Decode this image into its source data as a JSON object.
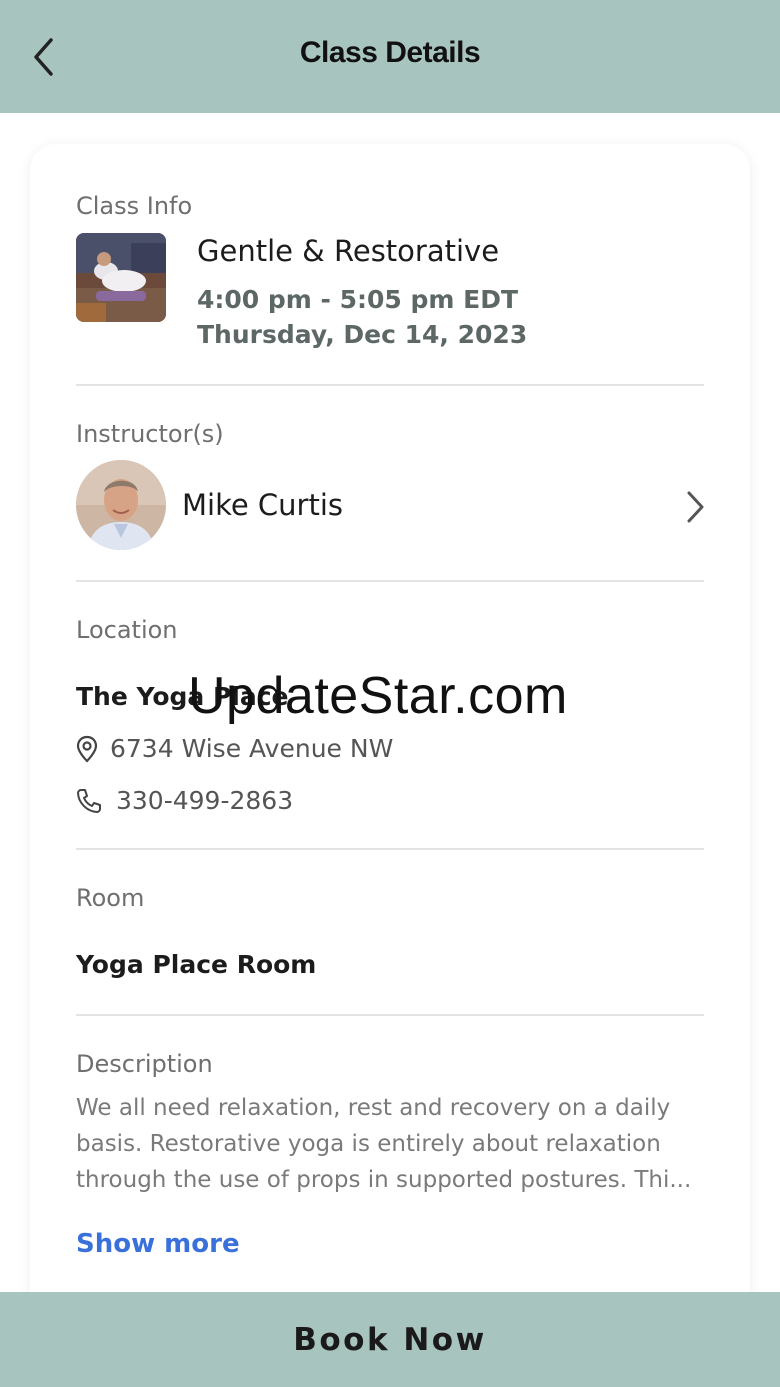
{
  "header": {
    "title": "Class Details",
    "back_icon": "chevron-left-icon"
  },
  "class_info": {
    "label": "Class Info",
    "name": "Gentle & Restorative",
    "time": "4:00 pm - 5:05 pm EDT",
    "date": "Thursday, Dec 14, 2023"
  },
  "instructor": {
    "label": "Instructor(s)",
    "name": "Mike Curtis"
  },
  "location": {
    "label": "Location",
    "name": "The Yoga Place",
    "address": "6734 Wise Avenue NW",
    "phone": "330-499-2863"
  },
  "room": {
    "label": "Room",
    "name": "Yoga Place Room"
  },
  "description": {
    "label": "Description",
    "text": "We all need relaxation, rest and recovery on a daily basis. Restorative yoga is entirely about relaxation through the use of props in supported postures. Thi...",
    "show_more": "Show more"
  },
  "footer": {
    "book_label": "Book Now"
  },
  "watermark": "UpdateStar.com",
  "colors": {
    "header_bg": "#a8c4bf",
    "link": "#3a70d9"
  }
}
